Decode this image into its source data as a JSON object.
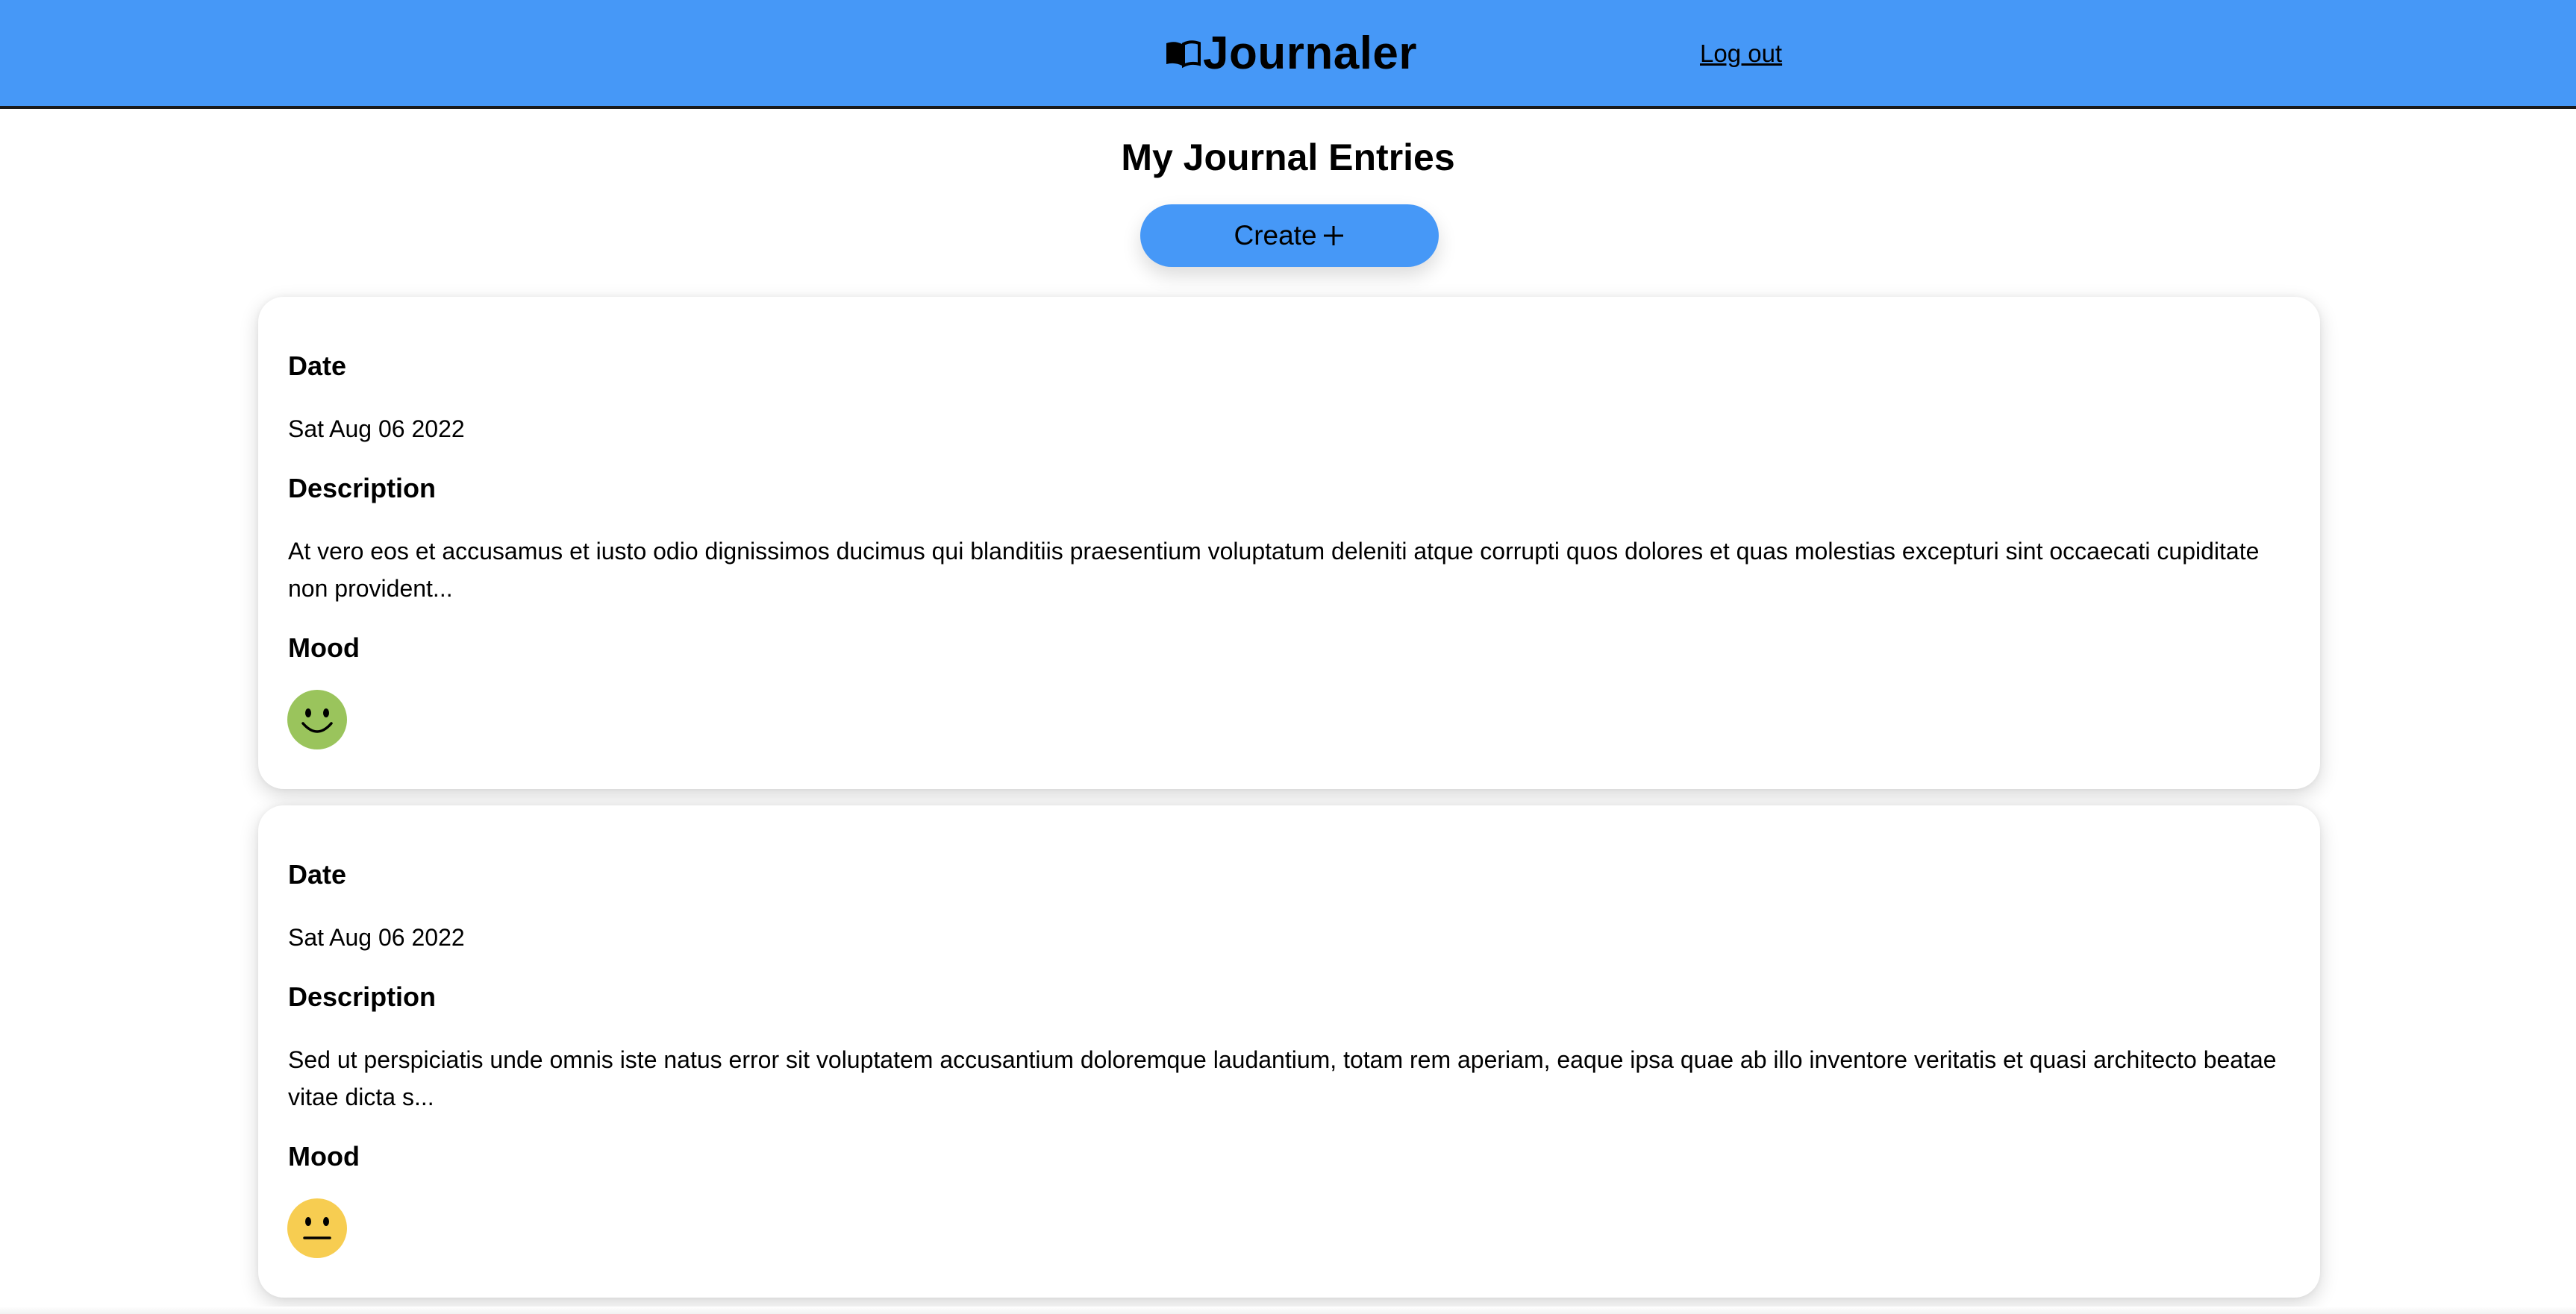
{
  "header": {
    "title": "Journaler",
    "logo_icon": "open-book-icon",
    "logout_label": "Log out"
  },
  "main": {
    "title": "My Journal Entries",
    "create_label": "Create",
    "create_icon": "plus-icon"
  },
  "entries": [
    {
      "date_label": "Date",
      "date": "Sat Aug 06 2022",
      "description_label": "Description",
      "description": "At vero eos et accusamus et iusto odio dignissimos ducimus qui blanditiis praesentium voluptatum deleniti atque corrupti quos dolores et quas molestias excepturi sint occaecati cupiditate non provident...",
      "mood_label": "Mood",
      "mood_icon": "happy-face-icon",
      "mood_color": "#9ac45c"
    },
    {
      "date_label": "Date",
      "date": "Sat Aug 06 2022",
      "description_label": "Description",
      "description": "Sed ut perspiciatis unde omnis iste natus error sit voluptatem accusantium doloremque laudantium, totam rem aperiam, eaque ipsa quae ab illo inventore veritatis et quasi architecto beatae vitae dicta s...",
      "mood_label": "Mood",
      "mood_icon": "neutral-face-icon",
      "mood_color": "#f7cd51"
    }
  ],
  "colors": {
    "accent": "#4698f7",
    "header_border": "#1a1a1a"
  }
}
